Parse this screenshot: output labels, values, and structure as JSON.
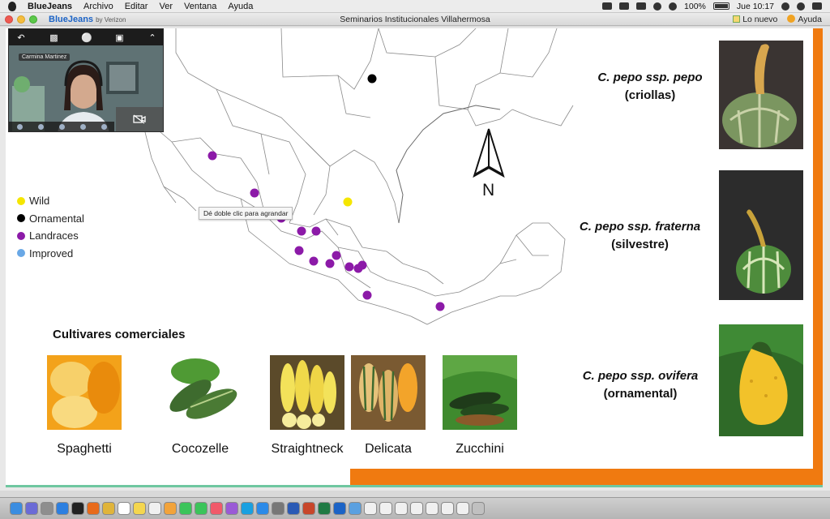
{
  "menubar": {
    "app_name": "BlueJeans",
    "menus": [
      "Archivo",
      "Editar",
      "Ver",
      "Ventana",
      "Ayuda"
    ],
    "battery": "100%",
    "clock": "Jue 10:17"
  },
  "window": {
    "brand": "BlueJeans",
    "brand_sub": "by Verizon",
    "title": "Seminarios Institucionales Villahermosa",
    "whats_new": "Lo nuevo",
    "help": "Ayuda"
  },
  "video": {
    "participant_name": "Carmina Martinez"
  },
  "slide": {
    "legend": [
      {
        "label": "Wild",
        "color": "#f5e600"
      },
      {
        "label": "Ornamental",
        "color": "#000000"
      },
      {
        "label": "Landraces",
        "color": "#8c1aa8"
      },
      {
        "label": "Improved",
        "color": "#69a8e6"
      }
    ],
    "tooltip": "Dé doble clic para agrandar",
    "north": "N",
    "subspecies": [
      {
        "name": "C. pepo ssp. pepo",
        "common": "(criollas)"
      },
      {
        "name": "C. pepo ssp. fraterna",
        "common": "(silvestre)"
      },
      {
        "name": "C. pepo ssp. ovifera",
        "common": "(ornamental)"
      }
    ],
    "cultivars_title": "Cultivares comerciales",
    "cultivars": [
      "Spaghetti",
      "Cocozelle",
      "Straightneck",
      "Delicata",
      "Zucchini"
    ]
  },
  "dock": {
    "icons": [
      "finder-icon",
      "siri-icon",
      "launchpad-icon",
      "safari-icon",
      "terminal-icon",
      "firefox-icon",
      "chrome-icon",
      "calendar-icon",
      "notes-icon",
      "reminders-icon",
      "photos-icon",
      "messages-icon",
      "facetime-icon",
      "music-icon",
      "podcasts-icon",
      "skype-icon",
      "app-store-icon",
      "system-prefs-icon",
      "word-icon",
      "powerpoint-icon",
      "excel-icon",
      "bluejeans-dock-icon",
      "preview-icon",
      "document-icon",
      "document-icon",
      "document-icon",
      "document-icon",
      "document-icon",
      "document-icon",
      "document-icon",
      "trash-icon"
    ]
  }
}
